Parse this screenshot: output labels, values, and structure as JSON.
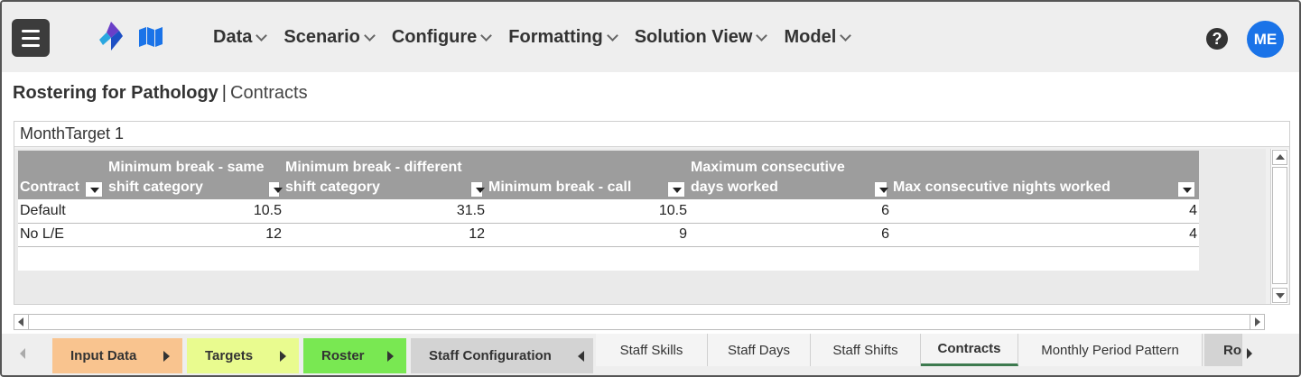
{
  "header": {
    "nav": [
      {
        "label": "Data"
      },
      {
        "label": "Scenario"
      },
      {
        "label": "Configure"
      },
      {
        "label": "Formatting"
      },
      {
        "label": "Solution View"
      },
      {
        "label": "Model"
      }
    ],
    "help_icon": "question-circle-icon",
    "help_text": "?",
    "avatar_initials": "ME"
  },
  "breadcrumb": {
    "app": "Rostering for Pathology",
    "separator": "|",
    "page": "Contracts"
  },
  "panel": {
    "title": "MonthTarget 1",
    "columns": [
      {
        "label": "Contract"
      },
      {
        "label": "Minimum break - same shift category"
      },
      {
        "label": "Minimum break - different shift category"
      },
      {
        "label": "Minimum break - call"
      },
      {
        "label": "Maximum consecutive days worked"
      },
      {
        "label": "Max consecutive nights worked"
      }
    ],
    "rows": [
      [
        "Default",
        "10.5",
        "31.5",
        "10.5",
        "6",
        "4"
      ],
      [
        "No L/E",
        "12",
        "12",
        "9",
        "6",
        "4"
      ]
    ]
  },
  "tabs": {
    "groups": [
      {
        "label": "Input Data",
        "color": "#f9c48f"
      },
      {
        "label": "Targets",
        "color": "#e9fb8f"
      },
      {
        "label": "Roster",
        "color": "#79e852"
      },
      {
        "label": "Staff Configuration",
        "color": "#d3d3d3"
      }
    ],
    "items": [
      {
        "label": "Staff Skills"
      },
      {
        "label": "Staff Days"
      },
      {
        "label": "Staff Shifts"
      },
      {
        "label": "Contracts"
      },
      {
        "label": "Monthly Period Pattern"
      },
      {
        "label": "Ro"
      }
    ],
    "active": "Contracts",
    "accent": "#3d7a4f"
  },
  "colors": {
    "header_bg": "#eeeeee",
    "grid_header_bg": "#9d9d9d",
    "avatar_bg": "#1a73e8",
    "menu_button_bg": "#3c3c3c"
  }
}
